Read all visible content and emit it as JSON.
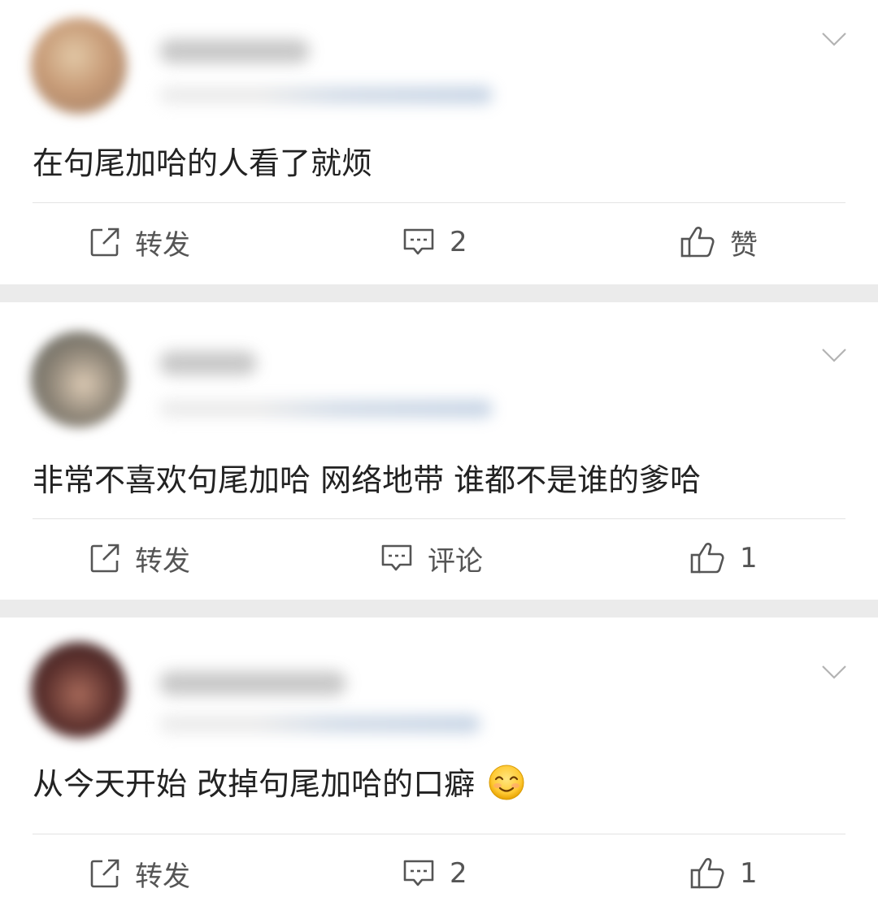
{
  "posts": [
    {
      "text": "在句尾加哈的人看了就烦",
      "repost_label": "转发",
      "comment_label": "2",
      "like_label": "赞"
    },
    {
      "text": "非常不喜欢句尾加哈 网络地带 谁都不是谁的爹哈",
      "repost_label": "转发",
      "comment_label": "评论",
      "like_label": "1"
    },
    {
      "text": "从今天开始 改掉句尾加哈的口癖",
      "repost_label": "转发",
      "comment_label": "2",
      "like_label": "1"
    }
  ],
  "icons": {
    "menu": "chevron-down-icon",
    "repost": "repost-icon",
    "comment": "comment-icon",
    "like": "thumbs-up-icon",
    "emoji": "smiling-face-emoji"
  },
  "colors": {
    "text": "#222222",
    "action_text": "#555555",
    "card": "#ffffff",
    "separator": "#ebebeb"
  }
}
